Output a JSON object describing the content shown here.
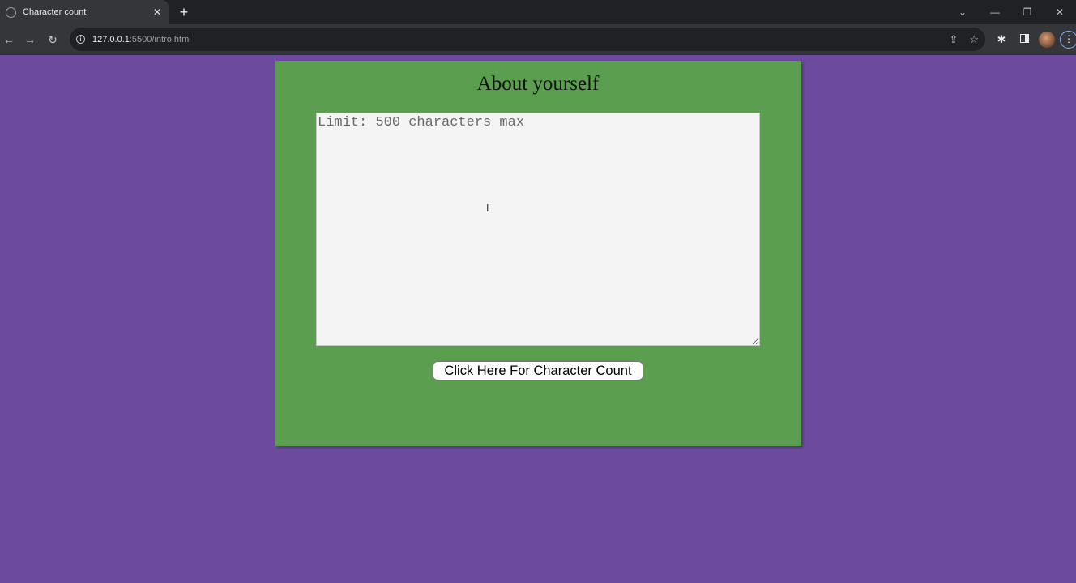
{
  "browser": {
    "tab": {
      "title": "Character count",
      "close": "✕",
      "favicon": "globe-icon"
    },
    "new_tab": "+",
    "window_controls": {
      "dropdown": "⌄",
      "minimize": "—",
      "restore": "❐",
      "close": "✕"
    },
    "nav": {
      "back": "←",
      "forward": "→",
      "reload": "↻"
    },
    "address": {
      "host": "127.0.0.1",
      "path": ":5500/intro.html"
    },
    "omnibox_icons": {
      "share": "⇪",
      "bookmark": "☆"
    },
    "extensions": {
      "puzzle": "✱",
      "menu": "⋮"
    }
  },
  "page": {
    "background": "#6c4a9e",
    "card_color": "#5b9e4f",
    "title": "About yourself",
    "textarea": {
      "placeholder": "Limit: 500 characters max",
      "value": ""
    },
    "button_label": "Click Here For Character Count"
  }
}
